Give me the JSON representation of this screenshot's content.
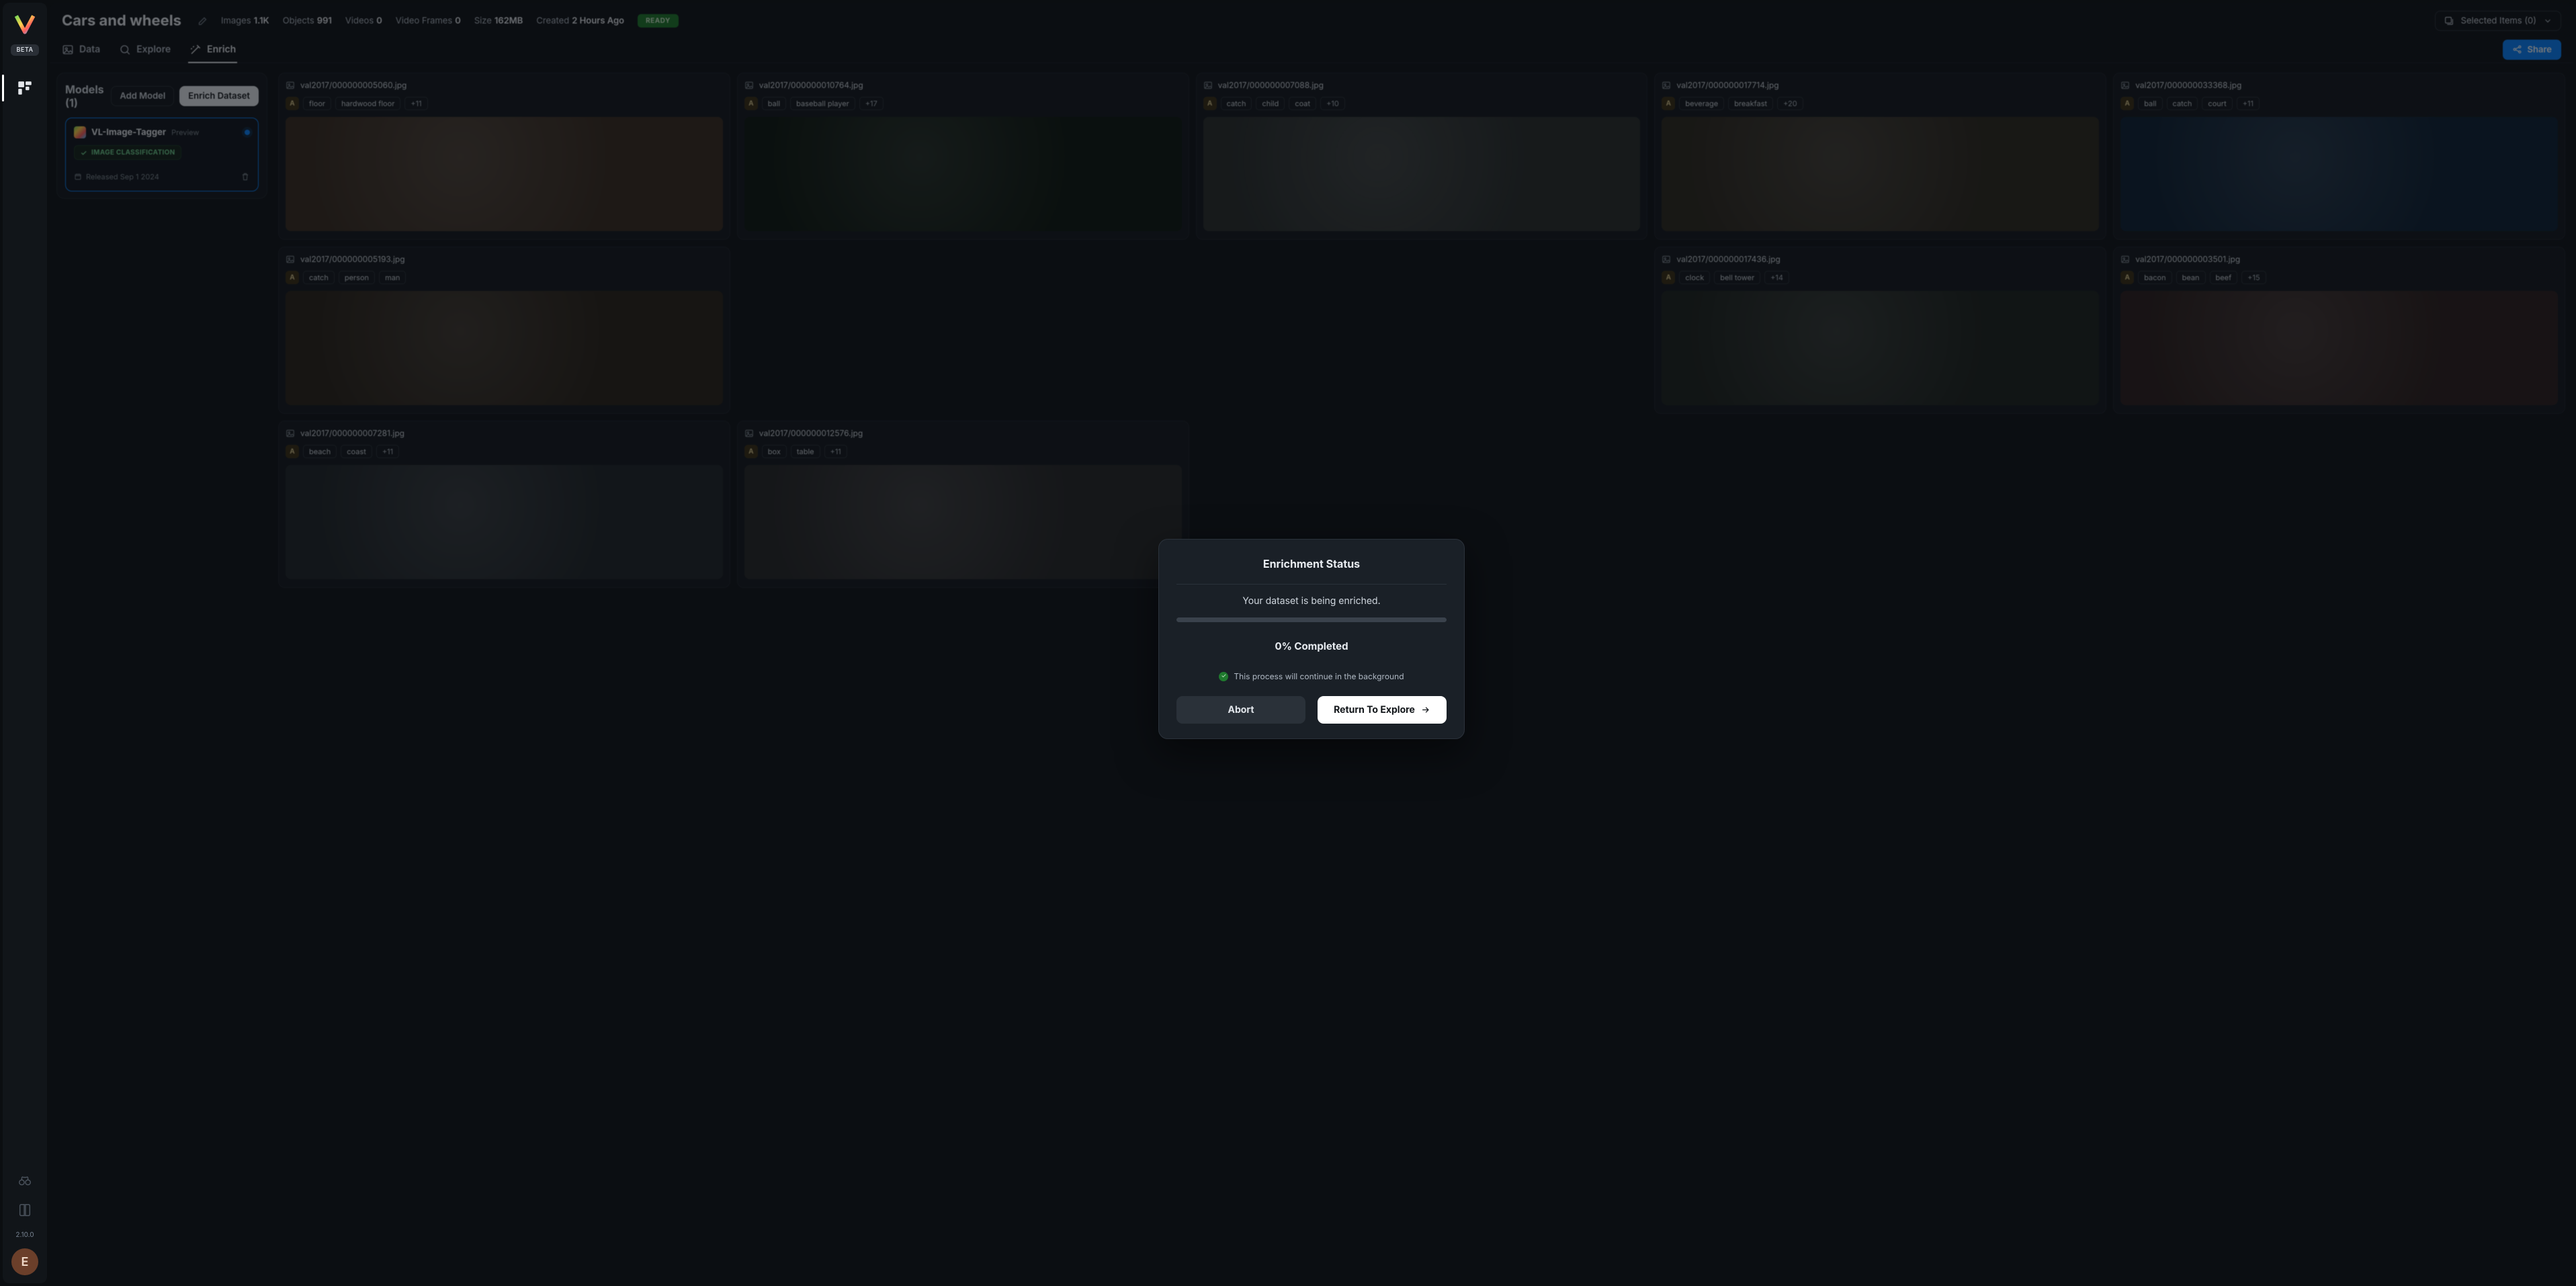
{
  "rail": {
    "beta": "BETA",
    "version": "2.10.0",
    "avatar_initial": "E"
  },
  "header": {
    "title": "Cars and wheels",
    "stats": {
      "images_label": "Images",
      "images_value": "1.1K",
      "objects_label": "Objects",
      "objects_value": "991",
      "videos_label": "Videos",
      "videos_value": "0",
      "frames_label": "Video Frames",
      "frames_value": "0",
      "size_label": "Size",
      "size_value": "162MB",
      "created_label": "Created",
      "created_value": "2 Hours Ago"
    },
    "status": "READY",
    "selected_label": "Selected Items (0)"
  },
  "tabs": {
    "data": "Data",
    "explore": "Explore",
    "enrich": "Enrich"
  },
  "share_label": "Share",
  "models": {
    "title": "Models (1)",
    "add": "Add Model",
    "enrich": "Enrich Dataset",
    "item": {
      "name": "VL-Image-Tagger",
      "preview": "Preview",
      "task": "IMAGE CLASSIFICATION",
      "released": "Released Sep 1 2024"
    }
  },
  "grid": [
    {
      "file": "val2017/000000005060.jpg",
      "tags": [
        "floor",
        "hardwood floor"
      ],
      "more": "+11",
      "bg": "#3a2e23"
    },
    {
      "file": "val2017/000000010764.jpg",
      "tags": [
        "ball",
        "baseball player"
      ],
      "more": "+17",
      "bg": "#0f1a12"
    },
    {
      "file": "val2017/000000007088.jpg",
      "tags": [
        "catch",
        "child",
        "coat"
      ],
      "more": "+10",
      "bg": "#2a2f2e"
    },
    {
      "file": "val2017/000000017714.jpg",
      "tags": [
        "beverage",
        "breakfast"
      ],
      "more": "+20",
      "bg": "#2e2a21"
    },
    {
      "file": "val2017/000000033368.jpg",
      "tags": [
        "ball",
        "catch",
        "court"
      ],
      "more": "+11",
      "bg": "#0e2236"
    },
    {
      "file": "val2017/000000005193.jpg",
      "tags": [
        "catch",
        "person",
        "man"
      ],
      "more": "",
      "bg": "#2b241b"
    },
    {
      "file": "",
      "tags": [],
      "more": "",
      "bg": "#12263a",
      "hidden": true
    },
    {
      "file": "",
      "tags": [],
      "more": "",
      "bg": "#1f2a34",
      "hidden": true
    },
    {
      "file": "val2017/000000017436.jpg",
      "tags": [
        "clock",
        "bell tower"
      ],
      "more": "+14",
      "bg": "#1e2420"
    },
    {
      "file": "val2017/000000003501.jpg",
      "tags": [
        "bacon",
        "bean",
        "beef"
      ],
      "more": "+15",
      "bg": "#2d211f"
    },
    {
      "file": "val2017/000000007281.jpg",
      "tags": [
        "beach",
        "coast"
      ],
      "more": "+11",
      "bg": "#20262a"
    },
    {
      "file": "val2017/000000012576.jpg",
      "tags": [
        "box",
        "table"
      ],
      "more": "+11",
      "bg": "#272829"
    }
  ],
  "modal": {
    "title": "Enrichment Status",
    "message": "Your dataset is being enriched.",
    "percent_label": "0% Completed",
    "percent_value": 0,
    "bg_note": "This process will continue in the background",
    "abort": "Abort",
    "return": "Return To Explore"
  }
}
